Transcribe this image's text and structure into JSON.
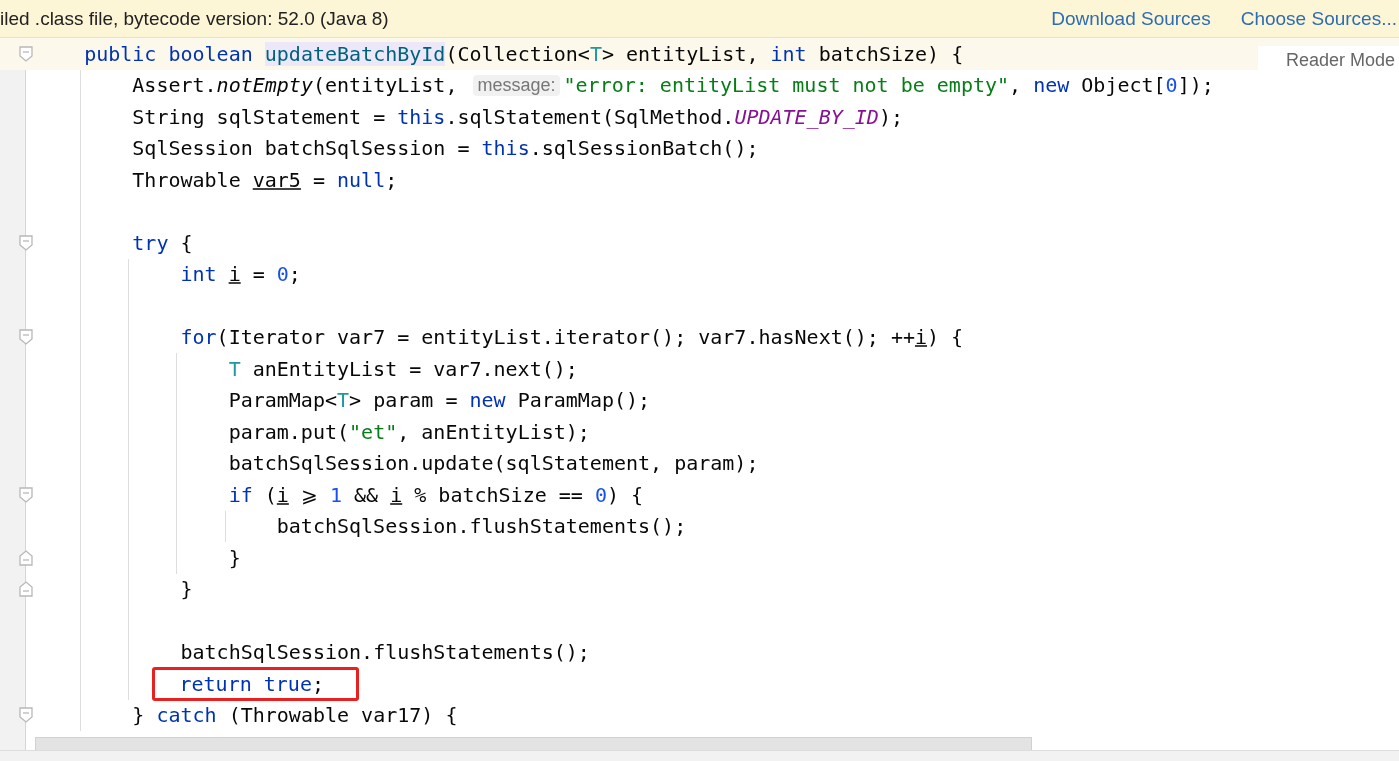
{
  "banner": {
    "text": "iled .class file, bytecode version: 52.0 (Java 8)",
    "links": [
      "Download Sources",
      "Choose Sources..."
    ]
  },
  "reader_mode": "Reader Mode",
  "code": [
    {
      "kind": "code",
      "fold_start": true,
      "current": true,
      "tokens": [
        {
          "kind": "keyword",
          "t": "public boolean "
        },
        {
          "kind": "highlight",
          "t": "updateBatchById"
        },
        {
          "kind": "plain",
          "t": "(Collection<"
        },
        {
          "kind": "typeparam",
          "t": "T"
        },
        {
          "kind": "plain",
          "t": "> entityList, "
        },
        {
          "kind": "keyword",
          "t": "int"
        },
        {
          "kind": "plain",
          "t": " batchSize) {"
        }
      ],
      "children": [
        {
          "kind": "code",
          "tokens": [
            {
              "kind": "plain",
              "t": "Assert."
            },
            {
              "kind": "italic",
              "t": "notEmpty"
            },
            {
              "kind": "plain",
              "t": "(entityList, "
            },
            {
              "kind": "hint",
              "t": "message:"
            },
            {
              "kind": "string",
              "t": "\"error: entityList must not be empty\""
            },
            {
              "kind": "plain",
              "t": ", "
            },
            {
              "kind": "keyword",
              "t": "new"
            },
            {
              "kind": "plain",
              "t": " Object["
            },
            {
              "kind": "number",
              "t": "0"
            },
            {
              "kind": "plain",
              "t": "]);"
            }
          ]
        },
        {
          "kind": "code",
          "tokens": [
            {
              "kind": "plain",
              "t": "String sqlStatement = "
            },
            {
              "kind": "keyword",
              "t": "this"
            },
            {
              "kind": "plain",
              "t": ".sqlStatement(SqlMethod."
            },
            {
              "kind": "constant",
              "t": "UPDATE_BY_ID"
            },
            {
              "kind": "plain",
              "t": ");"
            }
          ]
        },
        {
          "kind": "code",
          "tokens": [
            {
              "kind": "plain",
              "t": "SqlSession batchSqlSession = "
            },
            {
              "kind": "keyword",
              "t": "this"
            },
            {
              "kind": "plain",
              "t": ".sqlSessionBatch();"
            }
          ]
        },
        {
          "kind": "code",
          "tokens": [
            {
              "kind": "plain",
              "t": "Throwable "
            },
            {
              "kind": "underlined",
              "t": "var5"
            },
            {
              "kind": "plain",
              "t": " = "
            },
            {
              "kind": "keyword",
              "t": "null"
            },
            {
              "kind": "plain",
              "t": ";"
            }
          ]
        },
        {
          "kind": "blank"
        },
        {
          "kind": "code",
          "fold_start": true,
          "tokens": [
            {
              "kind": "keyword",
              "t": "try"
            },
            {
              "kind": "plain",
              "t": " {"
            }
          ],
          "children": [
            {
              "kind": "code",
              "tokens": [
                {
                  "kind": "keyword",
                  "t": "int "
                },
                {
                  "kind": "underlined",
                  "t": "i"
                },
                {
                  "kind": "plain",
                  "t": " = "
                },
                {
                  "kind": "number",
                  "t": "0"
                },
                {
                  "kind": "plain",
                  "t": ";"
                }
              ]
            },
            {
              "kind": "blank"
            },
            {
              "kind": "code",
              "fold_start": true,
              "tokens": [
                {
                  "kind": "keyword",
                  "t": "for"
                },
                {
                  "kind": "plain",
                  "t": "(Iterator var7 = entityList.iterator(); var7.hasNext(); ++"
                },
                {
                  "kind": "underlined",
                  "t": "i"
                },
                {
                  "kind": "plain",
                  "t": ") {"
                }
              ],
              "children": [
                {
                  "kind": "code",
                  "tokens": [
                    {
                      "kind": "typeparam",
                      "t": "T"
                    },
                    {
                      "kind": "plain",
                      "t": " anEntityList = var7.next();"
                    }
                  ]
                },
                {
                  "kind": "code",
                  "tokens": [
                    {
                      "kind": "plain",
                      "t": "ParamMap<"
                    },
                    {
                      "kind": "typeparam",
                      "t": "T"
                    },
                    {
                      "kind": "plain",
                      "t": "> param = "
                    },
                    {
                      "kind": "keyword",
                      "t": "new"
                    },
                    {
                      "kind": "plain",
                      "t": " ParamMap();"
                    }
                  ]
                },
                {
                  "kind": "code",
                  "tokens": [
                    {
                      "kind": "plain",
                      "t": "param.put("
                    },
                    {
                      "kind": "string",
                      "t": "\"et\""
                    },
                    {
                      "kind": "plain",
                      "t": ", anEntityList);"
                    }
                  ]
                },
                {
                  "kind": "code",
                  "tokens": [
                    {
                      "kind": "plain",
                      "t": "batchSqlSession.update(sqlStatement, param);"
                    }
                  ]
                },
                {
                  "kind": "code",
                  "fold_start": true,
                  "tokens": [
                    {
                      "kind": "keyword",
                      "t": "if"
                    },
                    {
                      "kind": "plain",
                      "t": " ("
                    },
                    {
                      "kind": "underlined",
                      "t": "i"
                    },
                    {
                      "kind": "plain",
                      "t": " ⩾ "
                    },
                    {
                      "kind": "number",
                      "t": "1"
                    },
                    {
                      "kind": "plain",
                      "t": " && "
                    },
                    {
                      "kind": "underlined",
                      "t": "i"
                    },
                    {
                      "kind": "plain",
                      "t": " % batchSize == "
                    },
                    {
                      "kind": "number",
                      "t": "0"
                    },
                    {
                      "kind": "plain",
                      "t": ") {"
                    }
                  ],
                  "children": [
                    {
                      "kind": "code",
                      "tokens": [
                        {
                          "kind": "plain",
                          "t": "batchSqlSession.flushStatements();"
                        }
                      ]
                    }
                  ]
                },
                {
                  "kind": "code",
                  "fold_end": true,
                  "tokens": [
                    {
                      "kind": "plain",
                      "t": "}"
                    }
                  ]
                }
              ]
            },
            {
              "kind": "code",
              "fold_end": true,
              "tokens": [
                {
                  "kind": "plain",
                  "t": "}"
                }
              ]
            },
            {
              "kind": "blank"
            },
            {
              "kind": "code",
              "tokens": [
                {
                  "kind": "plain",
                  "t": "batchSqlSession.flushStatements();"
                }
              ]
            },
            {
              "kind": "code",
              "boxed": true,
              "tokens": [
                {
                  "kind": "keyword",
                  "t": "return true"
                },
                {
                  "kind": "plain",
                  "t": ";"
                }
              ]
            }
          ]
        },
        {
          "kind": "code",
          "fold_start": true,
          "tokens": [
            {
              "kind": "plain",
              "t": "} "
            },
            {
              "kind": "keyword",
              "t": "catch"
            },
            {
              "kind": "plain",
              "t": " (Throwable var17) {"
            }
          ]
        }
      ]
    }
  ]
}
